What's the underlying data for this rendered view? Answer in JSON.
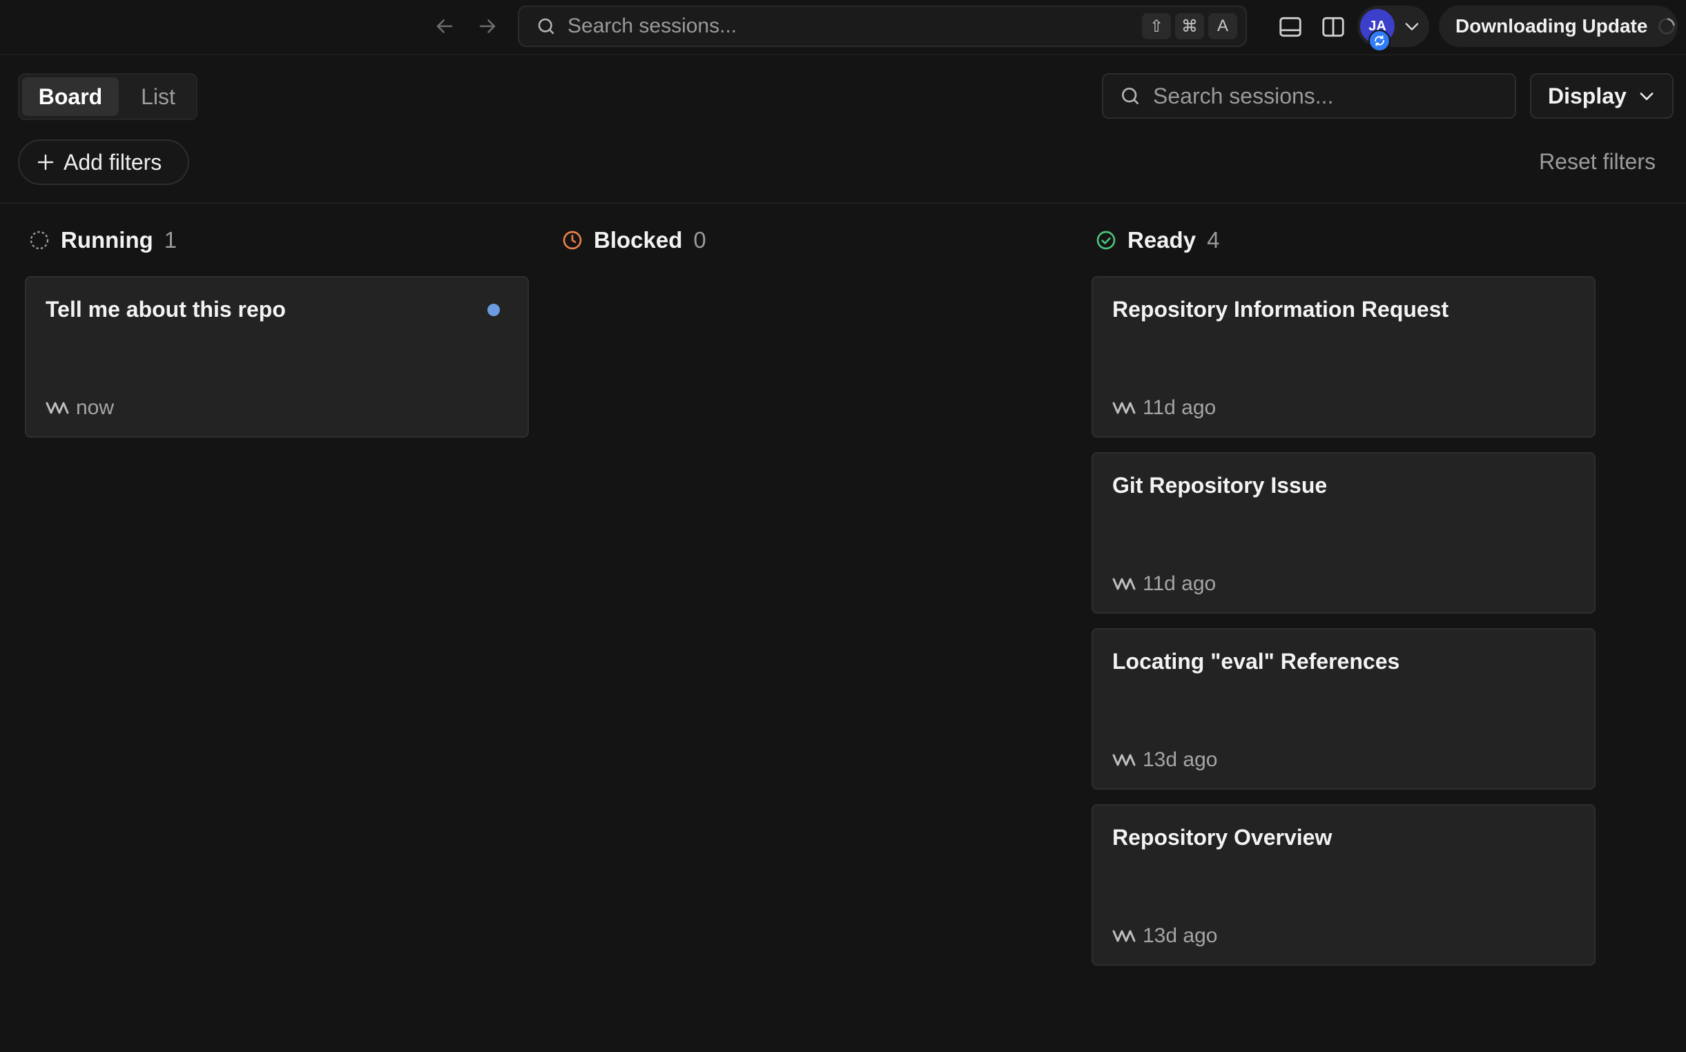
{
  "topbar": {
    "global_search_placeholder": "Search sessions...",
    "shortcut_keys": [
      "⇧",
      "⌘",
      "A"
    ],
    "avatar_initials": "JA",
    "update_label": "Downloading Update"
  },
  "toolbar": {
    "view_tabs": [
      {
        "label": "Board",
        "active": true
      },
      {
        "label": "List",
        "active": false
      }
    ],
    "search_placeholder": "Search sessions...",
    "display_label": "Display",
    "add_filters_label": "Add filters",
    "reset_filters_label": "Reset filters"
  },
  "columns": [
    {
      "title": "Running",
      "count": "1",
      "icon": "dashed-circle-icon",
      "color": "#9a9a9a",
      "cards": [
        {
          "title": "Tell me about this repo",
          "time": "now",
          "unread": true
        }
      ]
    },
    {
      "title": "Blocked",
      "count": "0",
      "icon": "clock-icon",
      "color": "#e8804a",
      "cards": []
    },
    {
      "title": "Ready",
      "count": "4",
      "icon": "check-circle-icon",
      "color": "#4cc27a",
      "cards": [
        {
          "title": "Repository Information Request",
          "time": "11d ago"
        },
        {
          "title": "Git Repository Issue",
          "time": "11d ago"
        },
        {
          "title": "Locating \"eval\" References",
          "time": "13d ago"
        },
        {
          "title": "Repository Overview",
          "time": "13d ago"
        }
      ]
    }
  ],
  "colors": {
    "background": "#141414",
    "card": "#232323",
    "avatar": "#3b3fc9",
    "unread_dot": "#6b9be0"
  }
}
